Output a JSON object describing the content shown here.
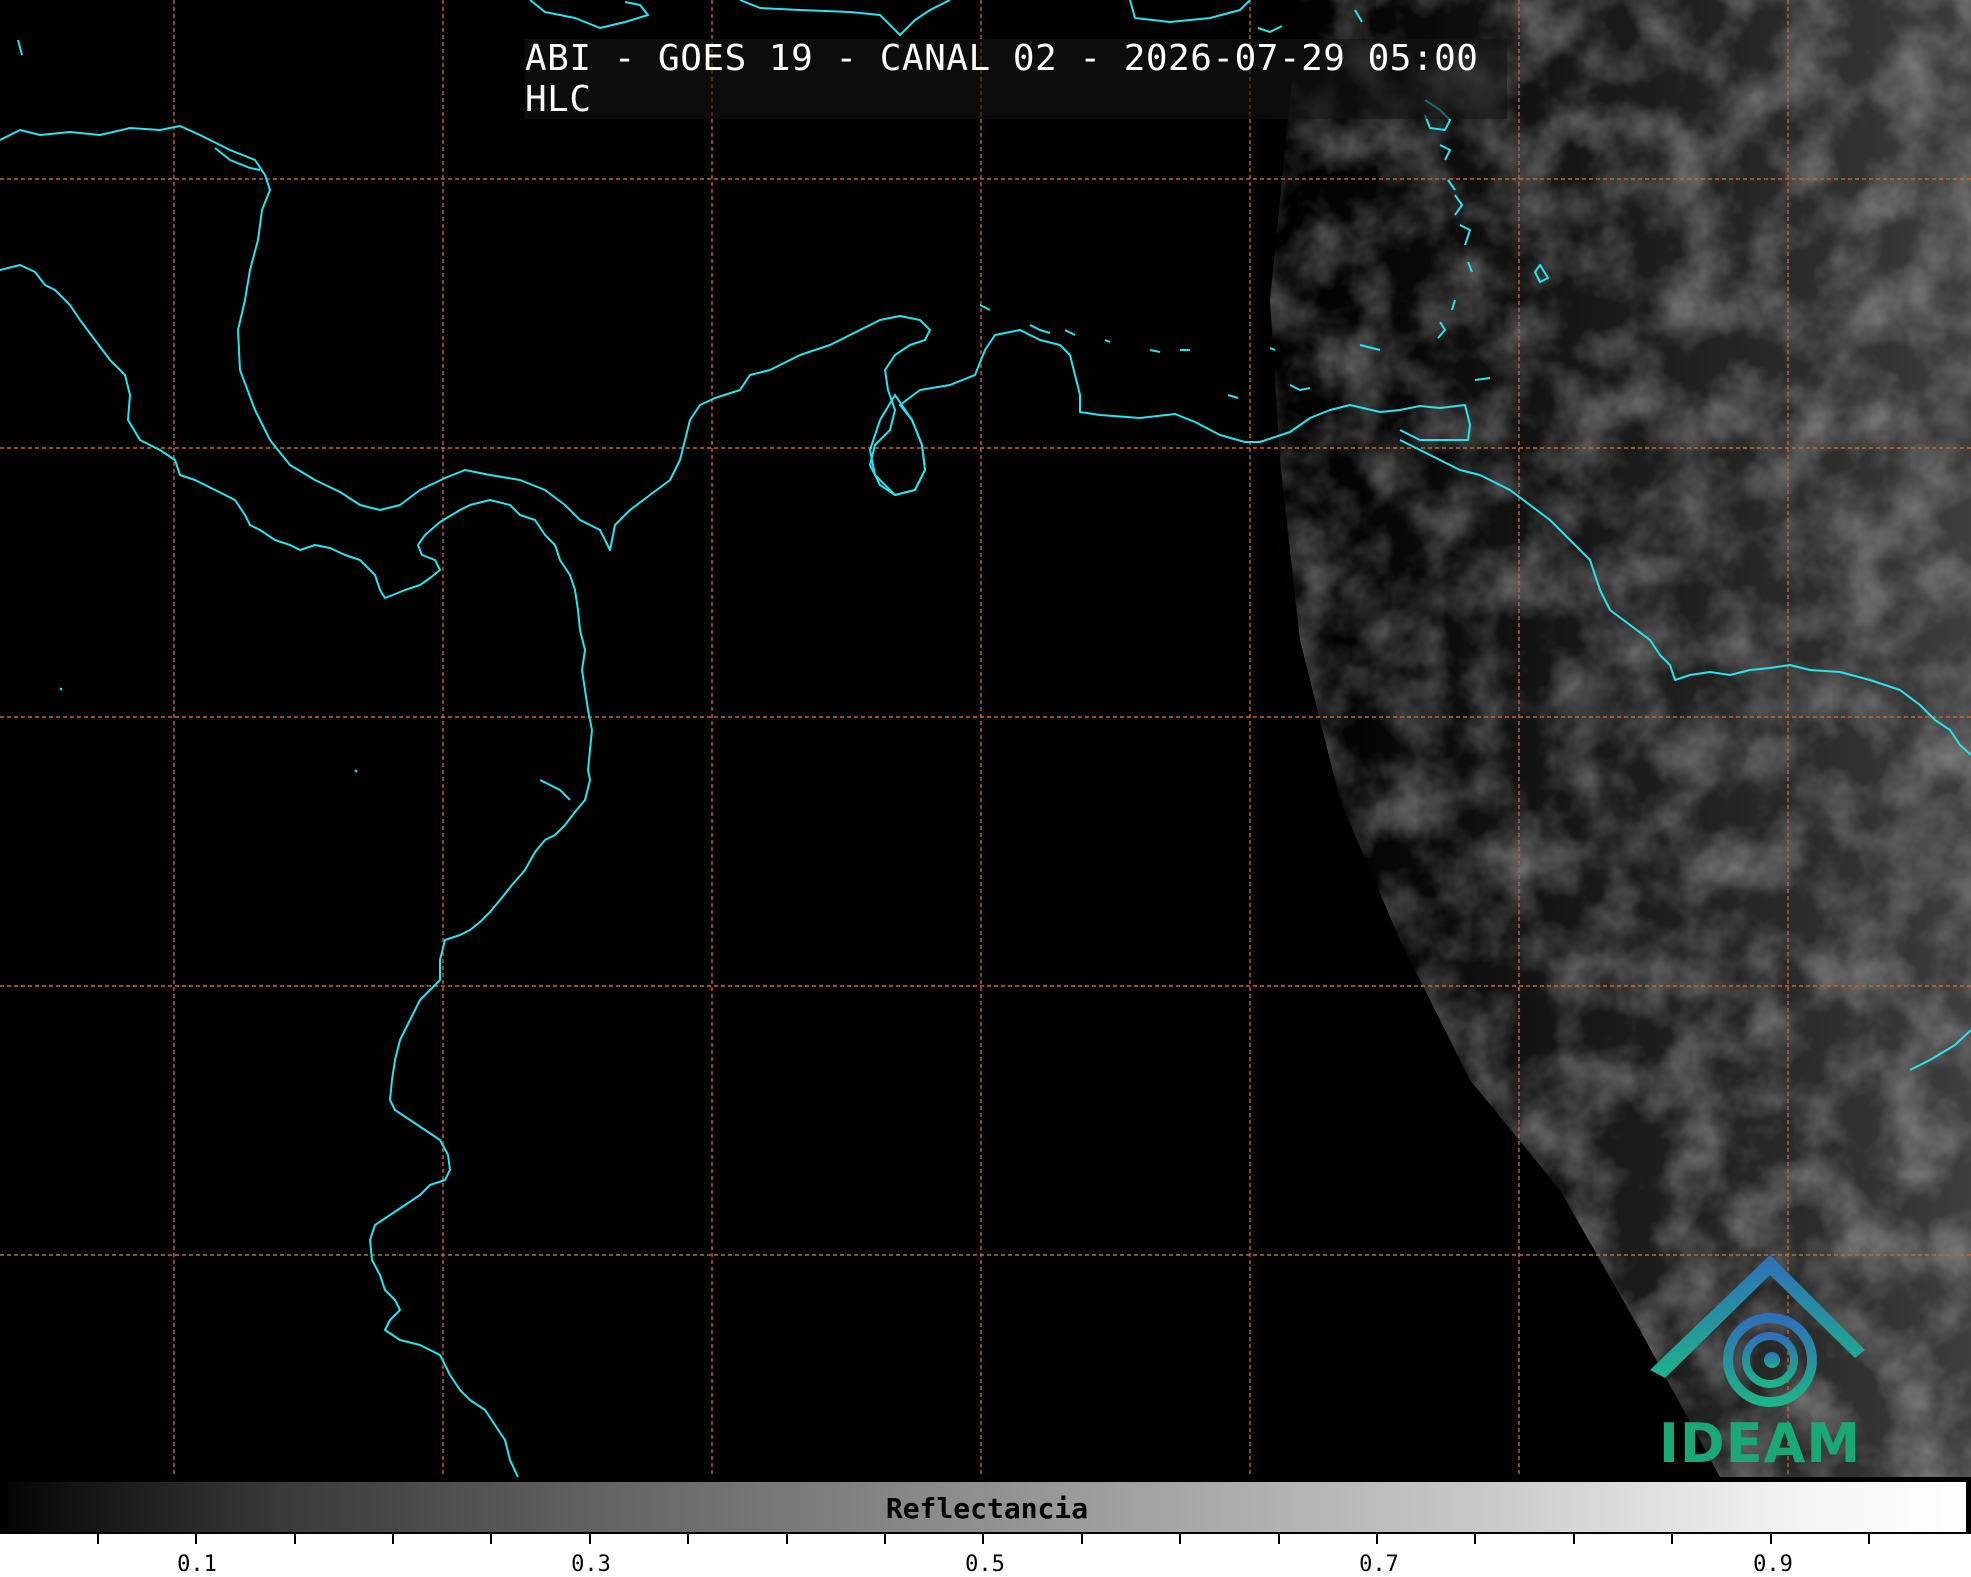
{
  "title": "ABI - GOES 19 - CANAL 02 - 2026-07-29 05:00 HLC",
  "colorbar": {
    "label": "Reflectancia",
    "ticks": [
      "0.1",
      "0.3",
      "0.5",
      "0.7",
      "0.9"
    ]
  },
  "logo": {
    "text": "IDEAM"
  },
  "colors": {
    "coastline": "#27e4ee",
    "gridlines": "#c8642a",
    "background": "#000000"
  }
}
